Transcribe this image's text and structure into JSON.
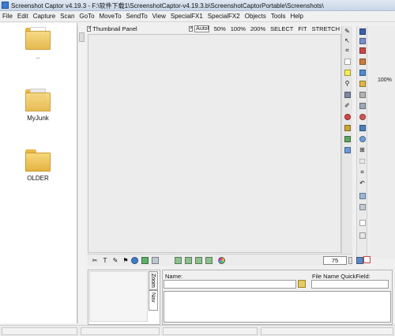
{
  "window": {
    "title": "Screenshot Captor v4.19.3 - F:\\软件下载1\\ScreenshotCaptor-v4.19.3.b\\ScreenshotCaptorPortable\\Screenshots\\",
    "minimize": "–",
    "maximize": "□",
    "close": "✕"
  },
  "menu": [
    "File",
    "Edit",
    "Capture",
    "Scan",
    "GoTo",
    "MoveTo",
    "SendTo",
    "View",
    "SpecialFX1",
    "SpecialFX2",
    "Objects",
    "Tools",
    "Help"
  ],
  "thumbnails": [
    {
      "label": "..",
      "icon": "folder-with-pages-icon"
    },
    {
      "label": "MyJunk",
      "icon": "folder-with-screenshot-icon"
    },
    {
      "label": "OLDER",
      "icon": "folder-icon"
    }
  ],
  "canvas_toolbar": {
    "thumbnail_panel": "Thumbnail Panel",
    "autofit_value": "AutoFit",
    "zoom_options": [
      "50%",
      "100%",
      "200%",
      "SELECT",
      "FIT",
      "STRETCH"
    ]
  },
  "zoom_percent_label": "100%",
  "bottom_toolbar": {
    "zoom_value": "75"
  },
  "nav_tabs": {
    "zoom": "Zoom",
    "nav": "Nav"
  },
  "properties": {
    "name_label": "Name:",
    "name_value": "",
    "quickfield_label": "File Name QuickField:",
    "quickfield_value": ""
  },
  "colors": {
    "title_bar": "#c9d6e6",
    "folder": "#e4b443",
    "canvas": "#ececec"
  }
}
